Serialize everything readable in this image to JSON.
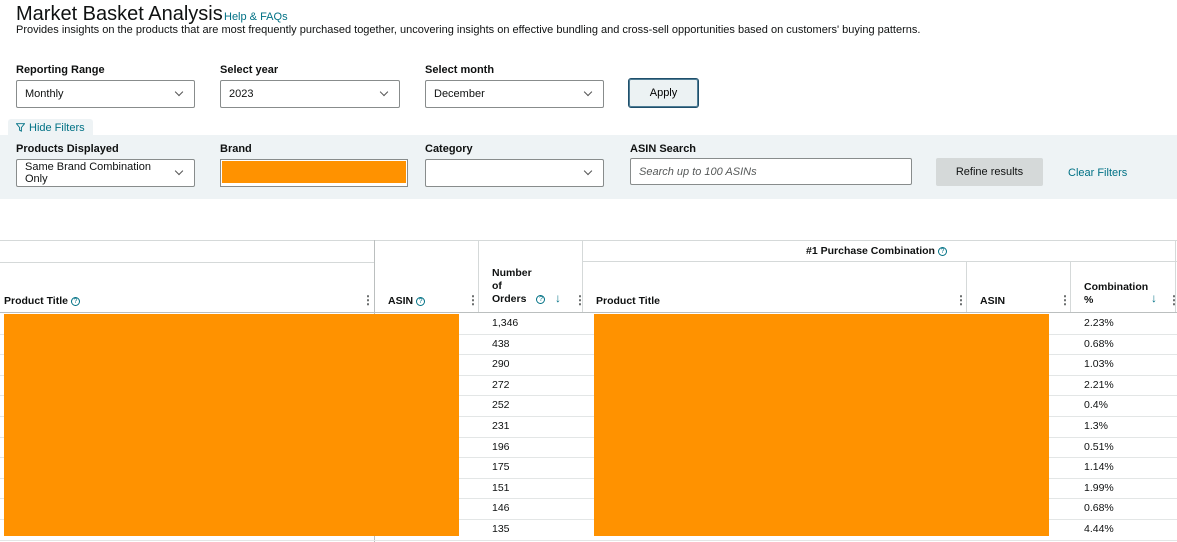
{
  "header": {
    "title": "Market Basket Analysis",
    "help_link": "Help & FAQs",
    "description": "Provides insights on the products that are most frequently purchased together, uncovering insights on effective bundling and cross-sell opportunities based on customers' buying patterns."
  },
  "controls": {
    "reporting_range": {
      "label": "Reporting Range",
      "value": "Monthly"
    },
    "year": {
      "label": "Select year",
      "value": "2023"
    },
    "month": {
      "label": "Select month",
      "value": "December"
    },
    "apply_label": "Apply"
  },
  "filters": {
    "toggle_label": "Hide Filters",
    "products_displayed": {
      "label": "Products Displayed",
      "value": "Same Brand Combination Only"
    },
    "brand": {
      "label": "Brand"
    },
    "category": {
      "label": "Category",
      "value": ""
    },
    "asin_search": {
      "label": "ASIN Search",
      "placeholder": "Search up to 100 ASINs"
    },
    "refine_label": "Refine results",
    "clear_label": "Clear Filters"
  },
  "table": {
    "group_header": "#1 Purchase Combination",
    "columns": {
      "product_title": "Product Title",
      "asin": "ASIN",
      "orders_line1": "Number",
      "orders_line2": "of",
      "orders_line3": "Orders",
      "combo_product_title": "Product Title",
      "combo_asin": "ASIN",
      "combination_line1": "Combination",
      "combination_line2": "%"
    },
    "rows": [
      {
        "orders": "1,346",
        "combination": "2.23%"
      },
      {
        "orders": "438",
        "combination": "0.68%"
      },
      {
        "orders": "290",
        "combination": "1.03%"
      },
      {
        "orders": "272",
        "combination": "2.21%"
      },
      {
        "orders": "252",
        "combination": "0.4%"
      },
      {
        "orders": "231",
        "combination": "1.3%"
      },
      {
        "orders": "196",
        "combination": "0.51%"
      },
      {
        "orders": "175",
        "combination": "1.14%"
      },
      {
        "orders": "151",
        "combination": "1.99%"
      },
      {
        "orders": "146",
        "combination": "0.68%"
      },
      {
        "orders": "135",
        "combination": "4.44%"
      }
    ]
  },
  "colors": {
    "redaction": "#ff9200",
    "link": "#007185",
    "filter_bg": "#eef3f5"
  }
}
